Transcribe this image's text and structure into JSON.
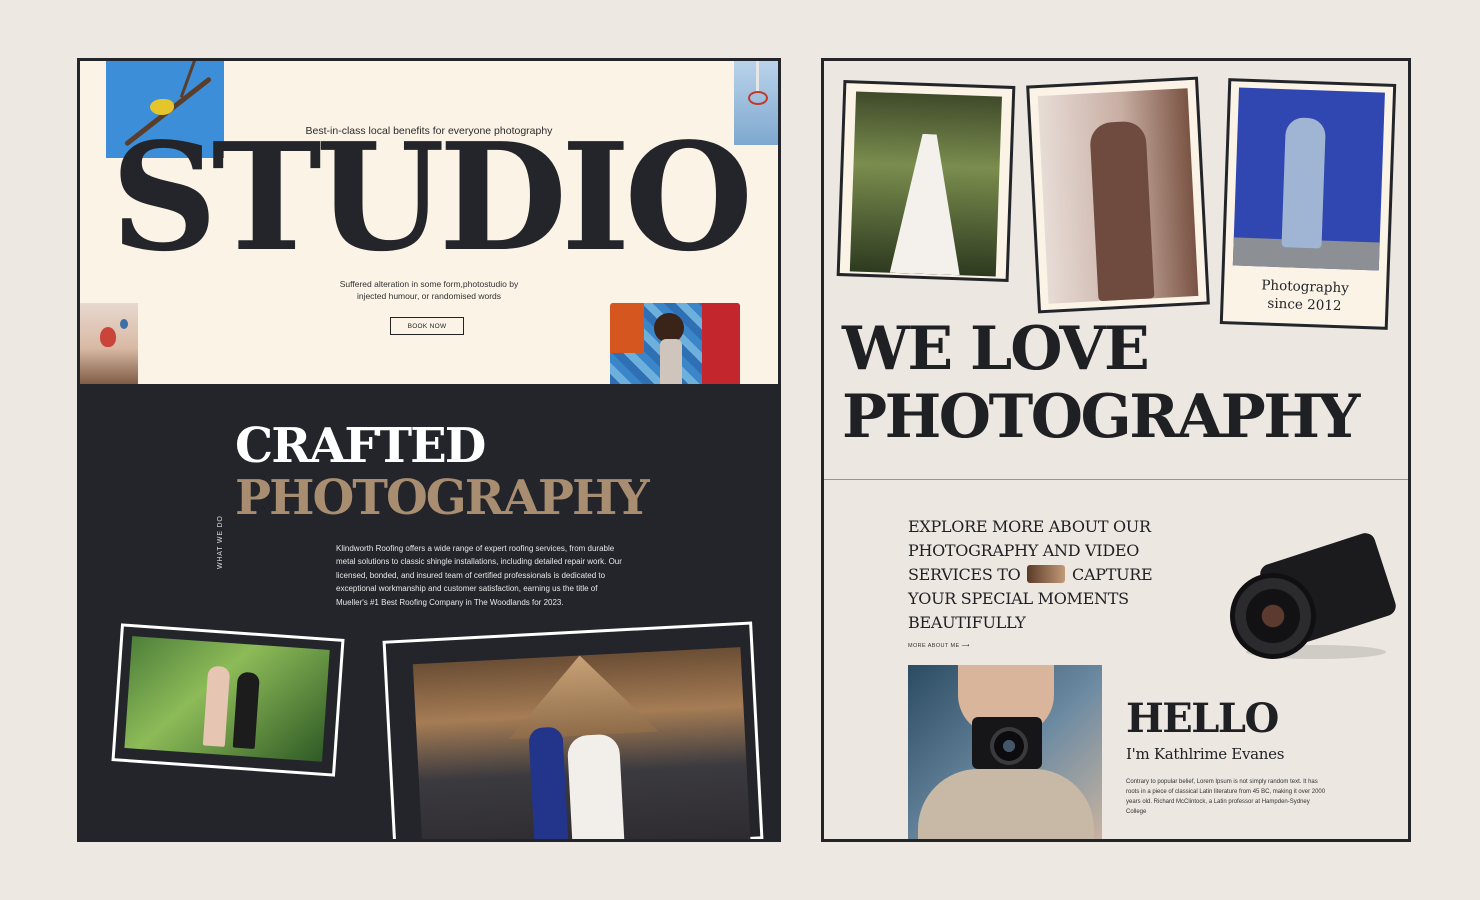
{
  "left": {
    "hero": {
      "tagline": "Best-in-class local benefits for everyone photography",
      "title": "STUDIO",
      "subtitle": "Suffered alteration in some form,photostudio by injected humour, or randomised words",
      "book_button": "BOOK NOW"
    },
    "crafted": {
      "line1": "CRAFTED",
      "line2": "PHOTOGRAPHY",
      "side_label": "WHAT WE DO",
      "paragraph": "Klindworth Roofing offers a wide range of expert roofing services, from durable metal solutions to classic shingle installations, including detailed repair work. Our licensed, bonded, and insured team of certified professionals is dedicated to exceptional workmanship and customer satisfaction, earning us the title of Mueller's #1 Best Roofing Company in The Woodlands for 2023."
    }
  },
  "right": {
    "photo_caption": "Photography\nsince 2012",
    "headline_line1": "WE LOVE",
    "headline_line2": "PHOTOGRAPHY",
    "explore_part1": "EXPLORE MORE ABOUT OUR PHOTOGRAPHY AND VIDEO SERVICES TO",
    "explore_part2": "CAPTURE YOUR SPECIAL MOMENTS BEAUTIFULLY",
    "more_link": "MORE ABOUT ME ⟶",
    "hello": "HELLO",
    "intro": "I'm Kathlrime Evanes",
    "paragraph": "Contrary to popular belief, Lorem Ipsum is not simply random text. It has roots in a piece of classical Latin literature from 45 BC, making it over 2000 years old. Richard McClintock, a Latin professor at Hampden-Sydney College"
  },
  "colors": {
    "page_bg": "#ede8e2",
    "dark": "#23252a",
    "cream": "#faf3e6",
    "accent_tan": "#a88d71"
  }
}
